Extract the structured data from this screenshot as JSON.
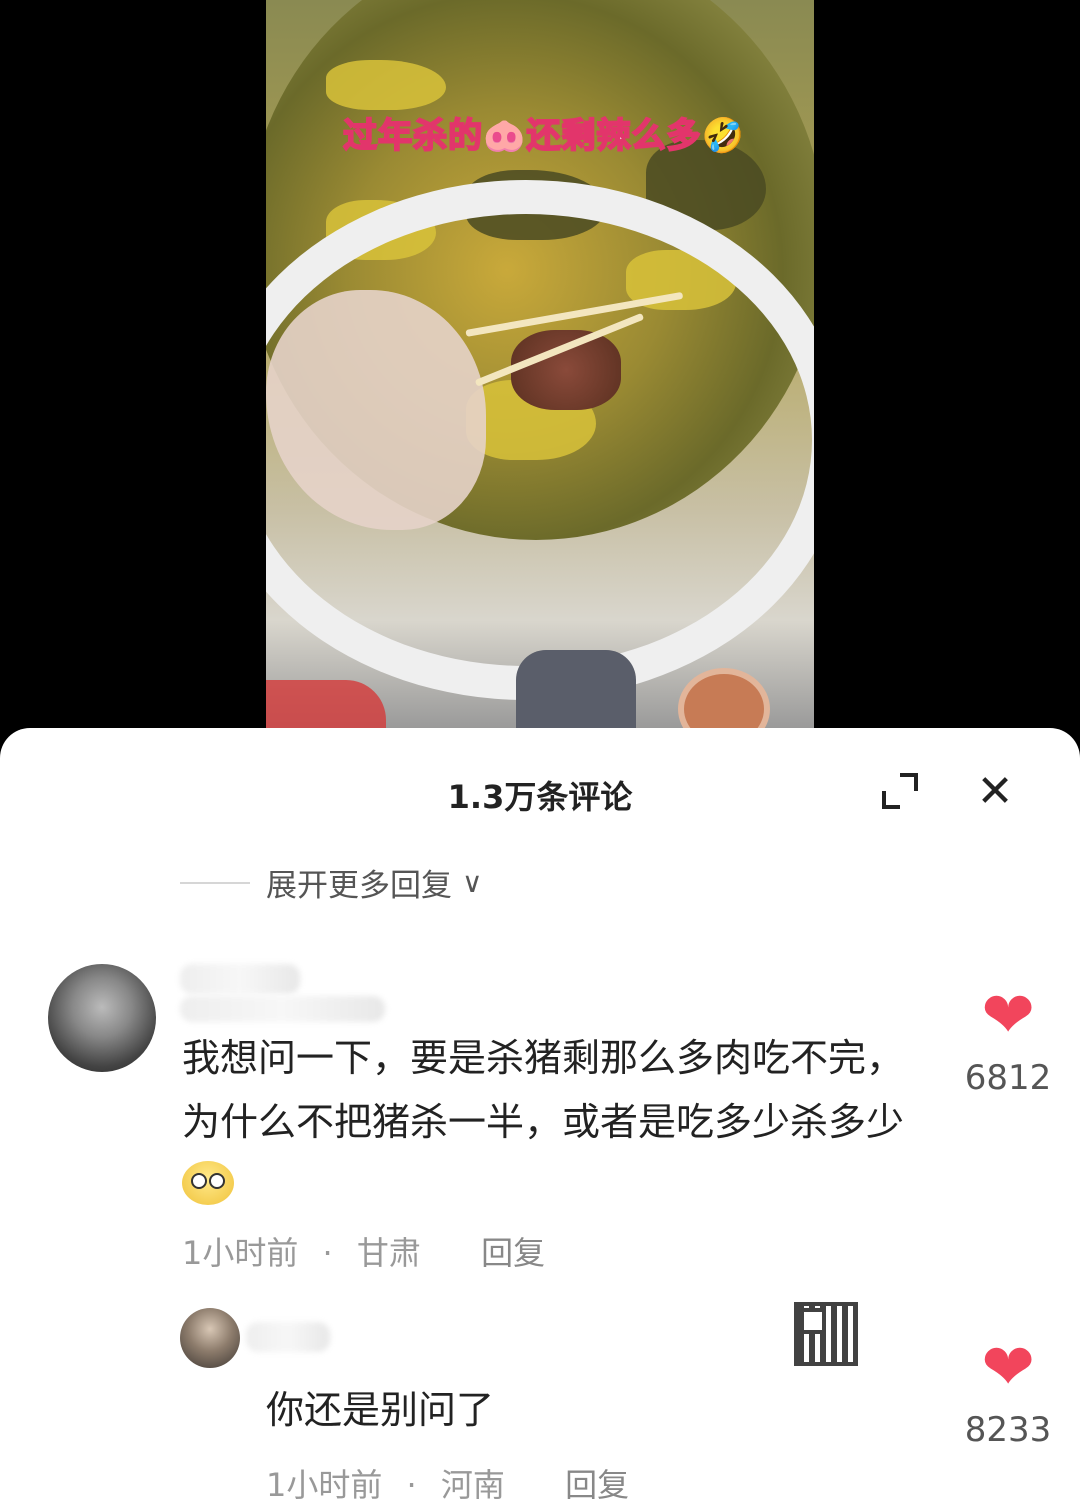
{
  "video": {
    "caption": "过年杀的🐽还剩辣么多🤣"
  },
  "sheet": {
    "title": "1.3万条评论",
    "expand_icon": "expand-icon",
    "close_icon": "close-icon",
    "close_glyph": "✕",
    "more_replies": "展开更多回复",
    "more_replies_icon": "chevron-down-icon",
    "more_replies_glyph": "∨"
  },
  "comments": [
    {
      "text": "我想问一下，要是杀猪剩那么多肉吃不完，为什么不把猪杀一半，或者是吃多少杀多少",
      "time": "1小时前",
      "separator": "·",
      "location": "甘肃",
      "reply_label": "回复",
      "likes": "6812",
      "heart_glyph": "❤"
    },
    {
      "text": "你还是别问了",
      "time": "1小时前",
      "separator": "·",
      "location": "河南",
      "reply_label": "回复",
      "likes": "8233",
      "heart_glyph": "❤"
    }
  ]
}
